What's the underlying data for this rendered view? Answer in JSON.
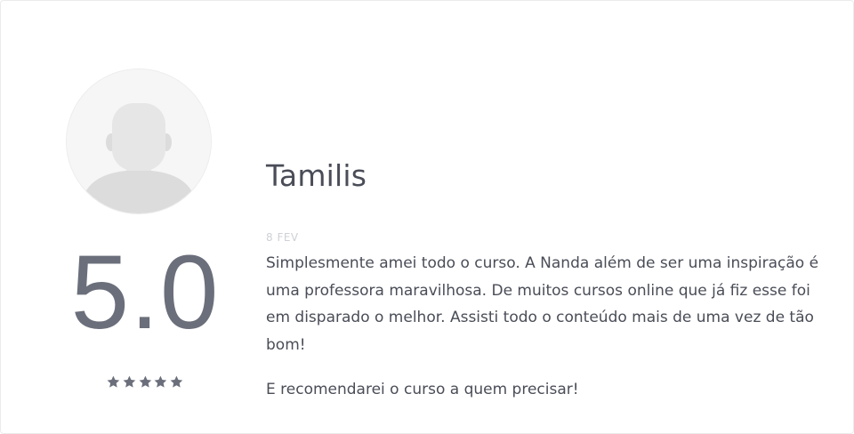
{
  "review": {
    "author_name": "Tamilis",
    "date": "8 FEV",
    "rating_value": "5.0",
    "stars": {
      "filled": 5,
      "total": 5,
      "color": "#6b6f7b"
    },
    "paragraphs": [
      "Simplesmente amei todo o curso. A Nanda além de ser uma inspiração é uma professora maravilhosa. De muitos cursos online que já fiz esse foi em disparado o melhor. Assisti todo o conteúdo mais de uma vez de tão bom!",
      "E recomendarei o curso a quem precisar!"
    ]
  },
  "avatar": {
    "icon": "default-user-avatar"
  },
  "colors": {
    "text_primary": "#4a4d57",
    "rating_text": "#6b6f7b",
    "date_text": "#cfd1d6",
    "border": "#ebebeb"
  }
}
